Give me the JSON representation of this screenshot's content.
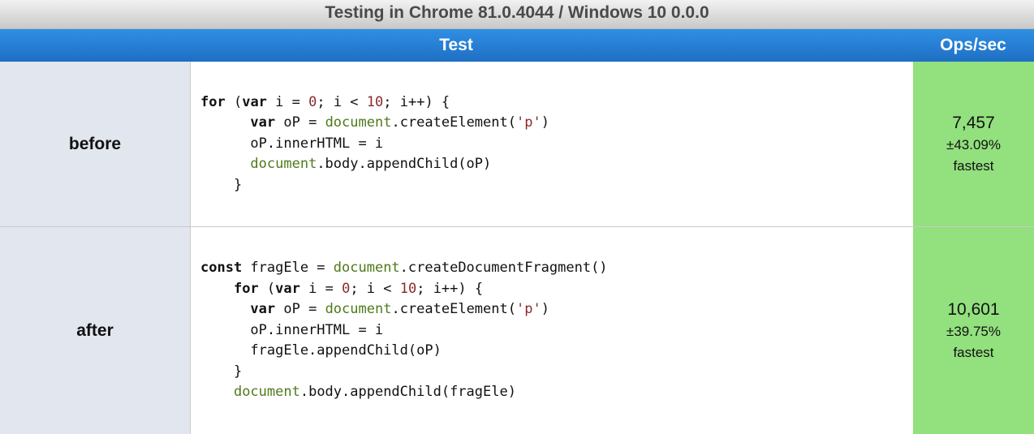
{
  "caption": "Testing in Chrome 81.0.4044 / Windows 10 0.0.0",
  "header": {
    "test_label": "Test",
    "ops_label": "Ops/sec"
  },
  "rows": [
    {
      "name": "before",
      "code": [
        [
          {
            "t": "for",
            "c": "kw"
          },
          {
            "t": " (",
            "c": ""
          },
          {
            "t": "var",
            "c": "kw"
          },
          {
            "t": " i = ",
            "c": ""
          },
          {
            "t": "0",
            "c": "n"
          },
          {
            "t": "; i < ",
            "c": ""
          },
          {
            "t": "10",
            "c": "n"
          },
          {
            "t": "; i++) {",
            "c": ""
          }
        ],
        [
          {
            "t": "      ",
            "c": ""
          },
          {
            "t": "var",
            "c": "kw"
          },
          {
            "t": " oP = ",
            "c": ""
          },
          {
            "t": "document",
            "c": "g"
          },
          {
            "t": ".createElement(",
            "c": ""
          },
          {
            "t": "'p'",
            "c": "n"
          },
          {
            "t": ")",
            "c": ""
          }
        ],
        [
          {
            "t": "      oP.innerHTML = i",
            "c": ""
          }
        ],
        [
          {
            "t": "      ",
            "c": ""
          },
          {
            "t": "document",
            "c": "g"
          },
          {
            "t": ".body.appendChild(oP)",
            "c": ""
          }
        ],
        [
          {
            "t": "    }",
            "c": ""
          }
        ]
      ],
      "ops": "7,457",
      "pct": "±43.09%",
      "rank": "fastest"
    },
    {
      "name": "after",
      "code": [
        [
          {
            "t": "const",
            "c": "kw"
          },
          {
            "t": " fragEle = ",
            "c": ""
          },
          {
            "t": "document",
            "c": "g"
          },
          {
            "t": ".createDocumentFragment()",
            "c": ""
          }
        ],
        [
          {
            "t": "    ",
            "c": ""
          },
          {
            "t": "for",
            "c": "kw"
          },
          {
            "t": " (",
            "c": ""
          },
          {
            "t": "var",
            "c": "kw"
          },
          {
            "t": " i = ",
            "c": ""
          },
          {
            "t": "0",
            "c": "n"
          },
          {
            "t": "; i < ",
            "c": ""
          },
          {
            "t": "10",
            "c": "n"
          },
          {
            "t": "; i++) {",
            "c": ""
          }
        ],
        [
          {
            "t": "      ",
            "c": ""
          },
          {
            "t": "var",
            "c": "kw"
          },
          {
            "t": " oP = ",
            "c": ""
          },
          {
            "t": "document",
            "c": "g"
          },
          {
            "t": ".createElement(",
            "c": ""
          },
          {
            "t": "'p'",
            "c": "n"
          },
          {
            "t": ")",
            "c": ""
          }
        ],
        [
          {
            "t": "      oP.innerHTML = i",
            "c": ""
          }
        ],
        [
          {
            "t": "      fragEle.appendChild(oP)",
            "c": ""
          }
        ],
        [
          {
            "t": "    }",
            "c": ""
          }
        ],
        [
          {
            "t": "    ",
            "c": ""
          },
          {
            "t": "document",
            "c": "g"
          },
          {
            "t": ".body.appendChild(fragEle)",
            "c": ""
          }
        ]
      ],
      "ops": "10,601",
      "pct": "±39.75%",
      "rank": "fastest"
    }
  ]
}
